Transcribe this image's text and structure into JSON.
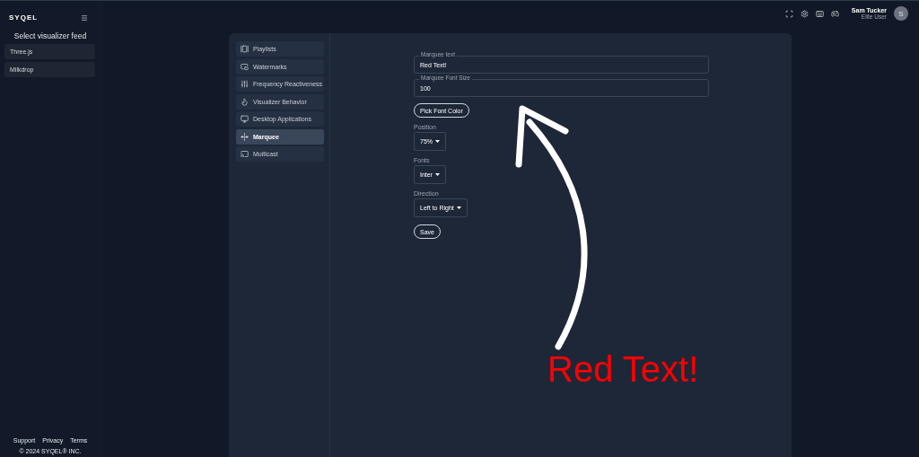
{
  "brand": "SYQEL",
  "sidebar": {
    "heading": "Select visualizer feed",
    "items": [
      {
        "label": "Three.js",
        "selected": false
      },
      {
        "label": "Milkdrop",
        "selected": false
      }
    ],
    "footer_links": [
      "Support",
      "Privacy",
      "Terms"
    ],
    "copyright": "© 2024 SYQEL® INC."
  },
  "user": {
    "name": "Sam Tucker",
    "role": "Elite User",
    "initial": "S"
  },
  "settings_menu": [
    {
      "label": "Playlists",
      "selected": false
    },
    {
      "label": "Watermarks",
      "selected": false
    },
    {
      "label": "Frequency Reactiveness",
      "selected": false
    },
    {
      "label": "Visualizer Behavior",
      "selected": false
    },
    {
      "label": "Desktop Applications",
      "selected": false
    },
    {
      "label": "Marquee",
      "selected": true
    },
    {
      "label": "Multicast",
      "selected": false
    }
  ],
  "form": {
    "fields": [
      {
        "label": "Marquee text",
        "value": "Red Text!"
      },
      {
        "label": "Marquee Font Size",
        "value": "100"
      }
    ],
    "color_button": "Pick Font Color",
    "dropdowns": [
      {
        "label": "Position",
        "value": "75%"
      },
      {
        "label": "Fonts",
        "value": "Inter"
      },
      {
        "label": "Direction",
        "value": "Left to Right"
      }
    ],
    "save_button": "Save"
  },
  "annotation": {
    "text": "Red Text!"
  }
}
